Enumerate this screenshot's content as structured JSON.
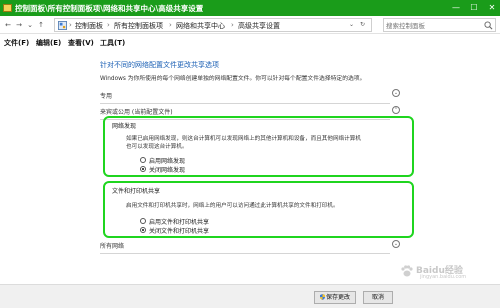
{
  "window": {
    "title": "控制面板\\所有控制面板项\\网络和共享中心\\高级共享设置",
    "accent_color": "#1a9c1a",
    "controls": {
      "minimize": "—",
      "maximize": "☐",
      "close": "✕"
    }
  },
  "address_bar": {
    "back": "←",
    "forward": "→",
    "recent": "⌄",
    "up": "↑",
    "crumbs": [
      "控制面板",
      "所有控制面板项",
      "网络和共享中心",
      "高级共享设置"
    ],
    "separator": "›",
    "dropdown": "⌄",
    "refresh": "↻",
    "search_placeholder": "搜索控制面板"
  },
  "menu": [
    "文件(F)",
    "编辑(E)",
    "查看(V)",
    "工具(T)"
  ],
  "page": {
    "title": "针对不同的网络配置文件更改共享选项",
    "description": "Windows 为你所使用的每个网络创建单独的网络配置文件。你可以针对每个配置文件选择特定的选项。"
  },
  "sections": {
    "private": {
      "label": "专用",
      "chevron": "⌄"
    },
    "guest_public": {
      "label": "来宾或公用 (当前配置文件)",
      "chevron": "⌃",
      "network_discovery": {
        "title": "网络发现",
        "description_lines": [
          "如果已启用网络发现，则这台计算机可以发现网络上的其他计算机和设备，而且其他网络计算机",
          "也可以发现这台计算机。"
        ],
        "options": [
          {
            "label": "启用网络发现",
            "checked": false
          },
          {
            "label": "关闭网络发现",
            "checked": true
          }
        ]
      },
      "file_printer_sharing": {
        "title": "文件和打印机共享",
        "description": "启用文件和打印机共享时，网络上的用户可以访问通过此计算机共享的文件和打印机。",
        "options": [
          {
            "label": "启用文件和打印机共享",
            "checked": false
          },
          {
            "label": "关闭文件和打印机共享",
            "checked": true
          }
        ]
      }
    },
    "all_networks": {
      "label": "所有网络",
      "chevron": "⌄"
    }
  },
  "footer": {
    "save_label": "保存更改",
    "cancel_label": "取消"
  },
  "highlight_color": "#1fd51f",
  "watermark": {
    "text": "Baidu经验",
    "sub": "jingyan.baidu.com"
  }
}
